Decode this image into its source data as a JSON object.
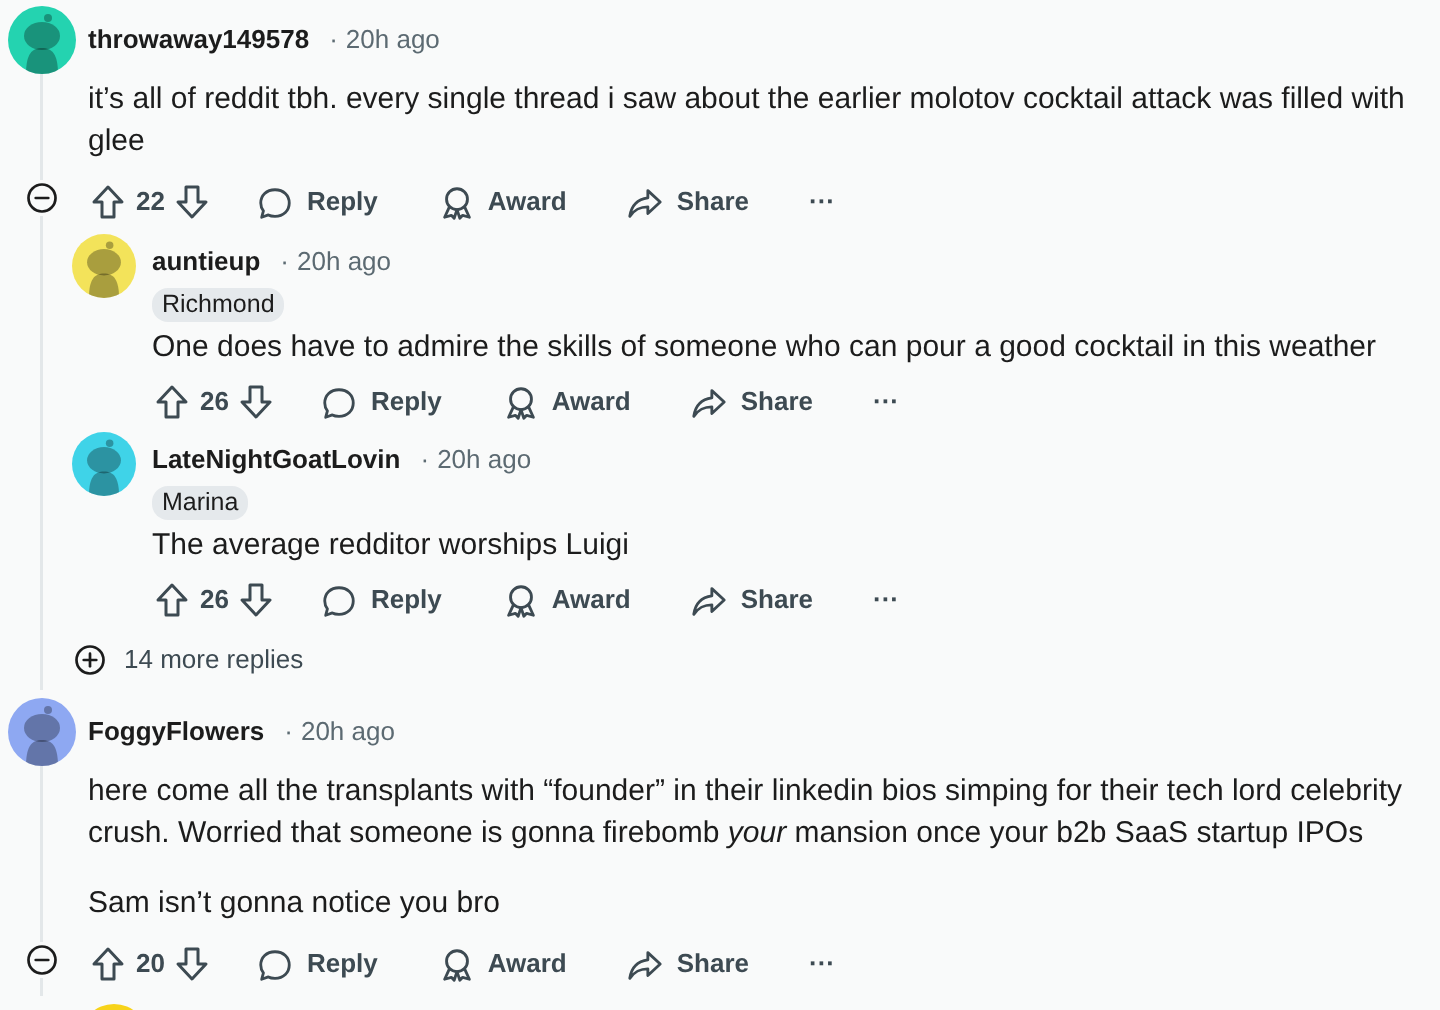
{
  "comments": [
    {
      "username": "throwaway149578",
      "dot": "·",
      "time": "20h ago",
      "avatar": {
        "color": "#24d3b0"
      },
      "body": [
        "it’s all of reddit tbh. every single thread i saw about the earlier molotov cocktail attack was filled with glee"
      ],
      "votes": "22",
      "expanded": true,
      "actions": [
        {
          "kind": "reply",
          "label": "Reply"
        },
        {
          "kind": "award",
          "label": "Award"
        },
        {
          "kind": "share",
          "label": "Share"
        }
      ],
      "more": "···",
      "replies": [
        {
          "username": "auntieup",
          "dot": "·",
          "time": "20h ago",
          "flair": "Richmond",
          "avatar": {
            "color": "#f3e35a"
          },
          "body": [
            "One does have to admire the skills of someone who can pour a good cocktail in this weather"
          ],
          "votes": "26",
          "actions": [
            {
              "kind": "reply",
              "label": "Reply"
            },
            {
              "kind": "award",
              "label": "Award"
            },
            {
              "kind": "share",
              "label": "Share"
            }
          ],
          "more": "···"
        },
        {
          "username": "LateNightGoatLovin",
          "dot": "·",
          "time": "20h ago",
          "flair": "Marina",
          "avatar": {
            "color": "#3fd3e8"
          },
          "body": [
            "The average redditor worships Luigi"
          ],
          "votes": "26",
          "actions": [
            {
              "kind": "reply",
              "label": "Reply"
            },
            {
              "kind": "award",
              "label": "Award"
            },
            {
              "kind": "share",
              "label": "Share"
            }
          ],
          "more": "···"
        }
      ],
      "more_replies": "14 more replies"
    },
    {
      "username": "FoggyFlowers",
      "dot": "·",
      "time": "20h ago",
      "avatar": {
        "color": "#8ea8f2"
      },
      "body": [
        "here come all the transplants with “founder” in their linkedin bios simping for their tech lord celebrity crush. Worried that someone is gonna firebomb *your* mansion once your b2b SaaS startup IPOs",
        "Sam isn’t gonna notice you bro"
      ],
      "votes": "20",
      "expanded": true,
      "actions": [
        {
          "kind": "reply",
          "label": "Reply"
        },
        {
          "kind": "award",
          "label": "Award"
        },
        {
          "kind": "share",
          "label": "Share"
        }
      ],
      "more": "···"
    }
  ],
  "next_comment_avatar": {
    "color": "#f7d31a"
  }
}
